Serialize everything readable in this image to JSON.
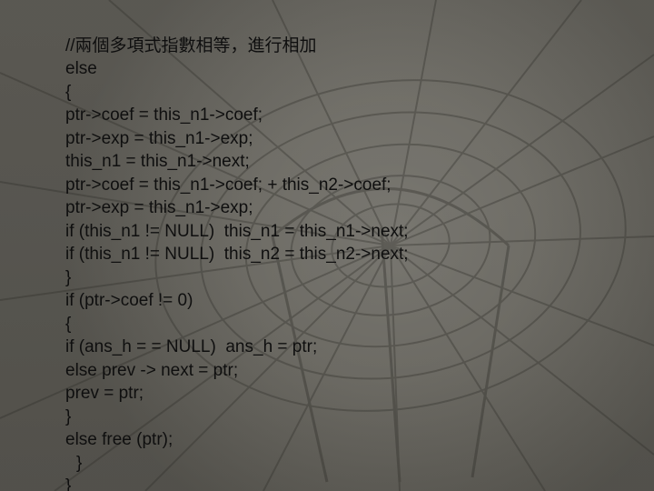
{
  "code": {
    "l1": "//兩個多項式指數相等，進行相加",
    "l2": "else",
    "l3": "{",
    "l4": "ptr->coef = this_n1->coef;",
    "l5": "ptr->exp = this_n1->exp;",
    "l6": "this_n1 = this_n1->next;",
    "l7": "ptr->coef = this_n1->coef; + this_n2->coef;",
    "l8": "ptr->exp = this_n1->exp;",
    "l9": "if (this_n1 != NULL)  this_n1 = this_n1->next;",
    "l10": "if (this_n1 != NULL)  this_n2 = this_n2->next;",
    "l11": "}",
    "l12": "if (ptr->coef != 0)",
    "l13": "{",
    "l14": "if (ans_h = = NULL)  ans_h = ptr;",
    "l15": "else prev -> next = ptr;",
    "l16": "prev = ptr;",
    "l17": "}",
    "l18": "else free (ptr);",
    "l19": "}",
    "l20": "}"
  }
}
